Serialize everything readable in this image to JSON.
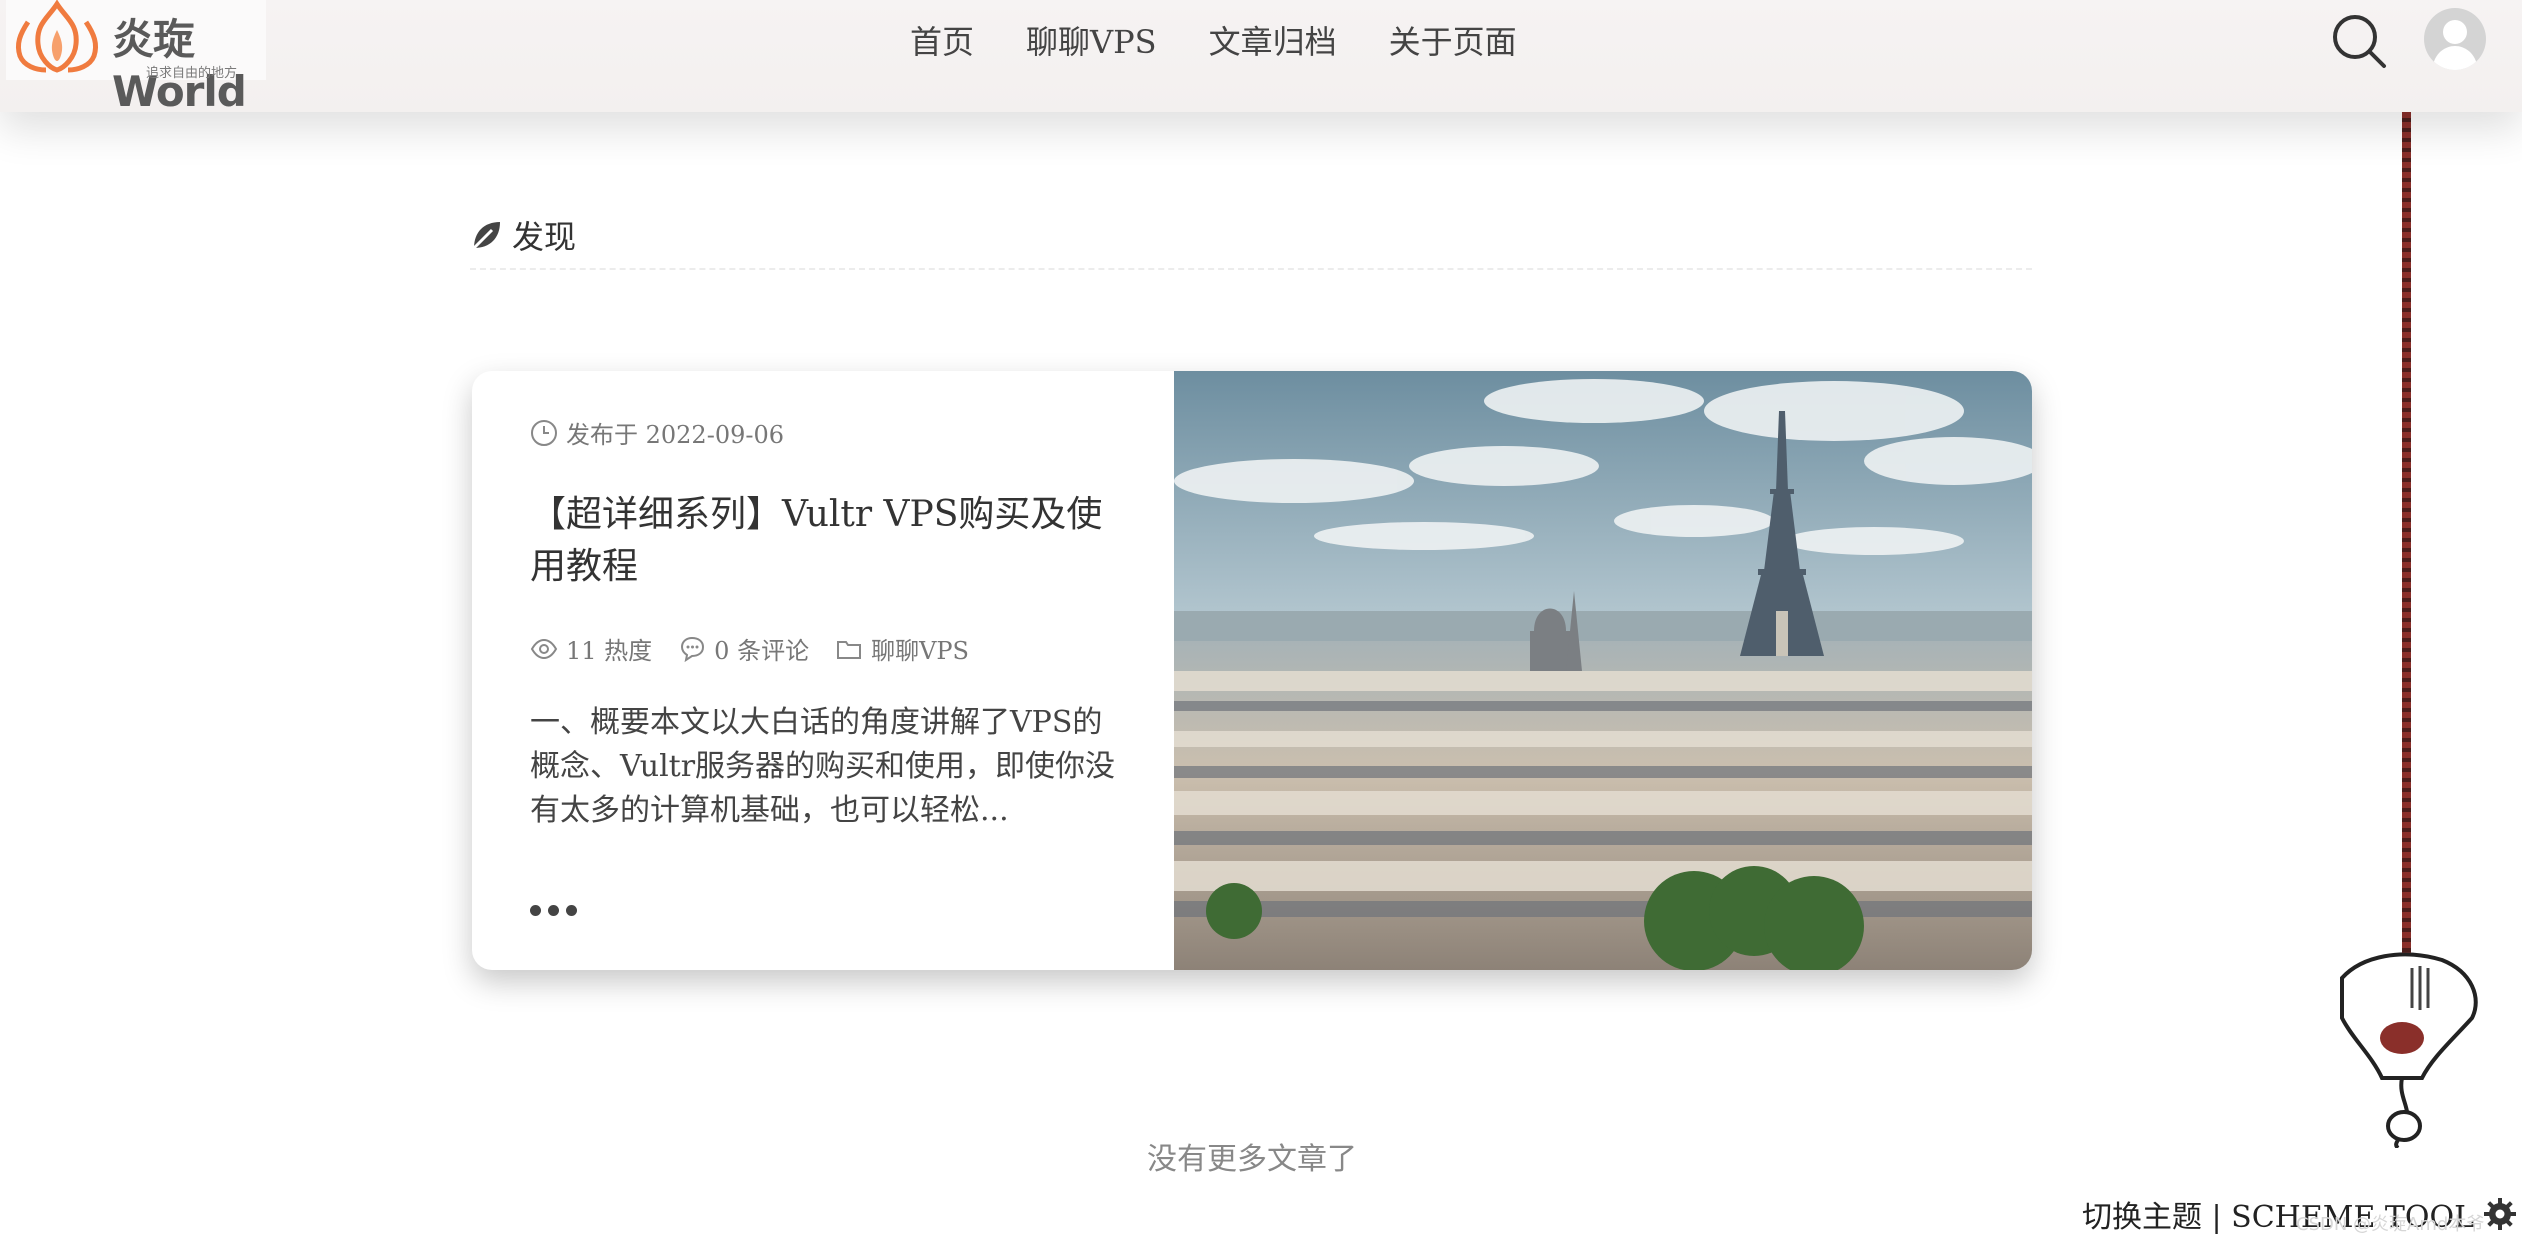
{
  "header": {
    "logo_text": "炎琁World",
    "logo_slogan": "追求自由的地方",
    "nav": [
      {
        "label": "首页"
      },
      {
        "label": "聊聊VPS"
      },
      {
        "label": "文章归档"
      },
      {
        "label": "关于页面"
      }
    ],
    "icons": {
      "search": "search-icon",
      "avatar": "user-avatar-icon"
    }
  },
  "section": {
    "title": "发现",
    "icon": "leaf-icon"
  },
  "post": {
    "date_label": "发布于 2022-09-06",
    "title": "【超详细系列】Vultr VPS购买及使用教程",
    "views": "11 热度",
    "comments": "0 条评论",
    "category": "聊聊VPS",
    "excerpt": "一、概要本文以大白话的角度讲解了VPS的概念、Vultr服务器的购买和使用，即使你没有太多的计算机基础，也可以轻松...",
    "image_alt": "Paris skyline with Eiffel Tower"
  },
  "footer": {
    "no_more": "没有更多文章了",
    "scheme_tool": "切换主题 | SCHEME TOOL",
    "watermark": "CSDN @炎琁Amd本爷"
  },
  "colors": {
    "header_bg": "#f4f1f0",
    "text": "#333333",
    "muted": "#777777",
    "logo_orange": "#f07b3f",
    "rope": "#7a2a26"
  }
}
